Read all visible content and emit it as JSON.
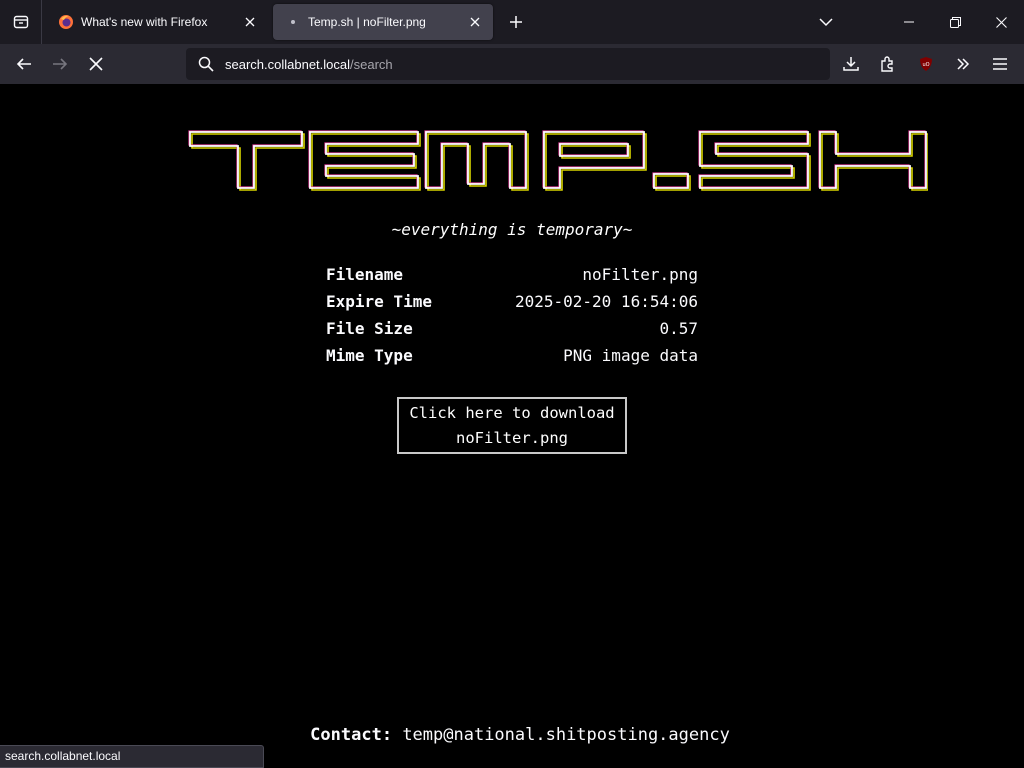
{
  "browser": {
    "tabs": [
      {
        "title": "What's new with Firefox",
        "icon": "firefox-icon",
        "active": false
      },
      {
        "title": "Temp.sh | noFilter.png",
        "icon": "globe-dot-icon",
        "active": true
      }
    ],
    "url": {
      "host": "search.collabnet.local",
      "path": "/search"
    },
    "status_text": "search.collabnet.local"
  },
  "page": {
    "logo_text": "TEMP.SH",
    "tagline": "~everything is temporary~",
    "info": [
      {
        "label": "Filename",
        "value": "noFilter.png"
      },
      {
        "label": "Expire Time",
        "value": "2025-02-20 16:54:06"
      },
      {
        "label": "File Size",
        "value": "0.57"
      },
      {
        "label": "Mime Type",
        "value": "PNG image data"
      }
    ],
    "download": {
      "line1": "Click here to download",
      "line2": "noFilter.png"
    },
    "contact": {
      "label": "Contact:",
      "email": "temp@national.shitposting.agency"
    }
  },
  "colors": {
    "page_bg": "#000000",
    "chrome_bg": "#1c1b22",
    "toolbar_bg": "#2b2a33",
    "ublock_red": "#800000"
  }
}
